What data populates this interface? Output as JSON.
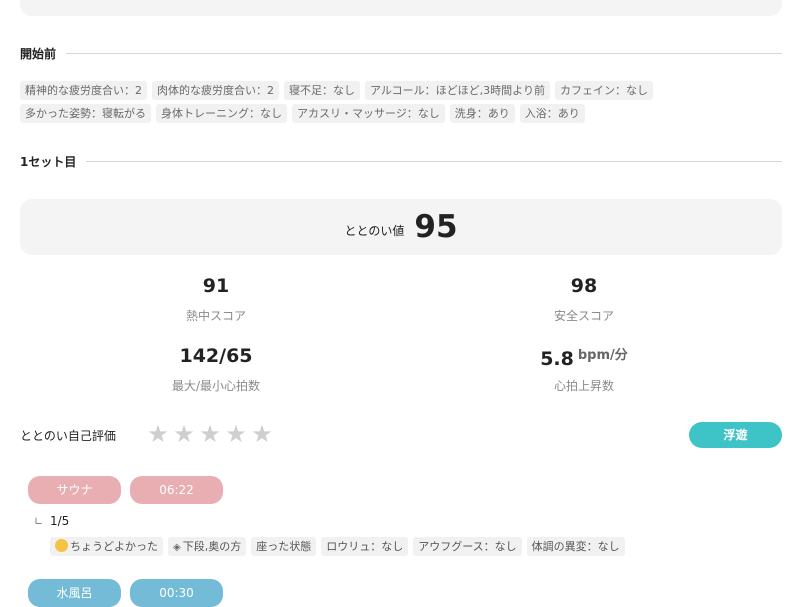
{
  "before": {
    "title": "開始前",
    "tags": [
      "精神的な疲労度合い：2",
      "肉体的な疲労度合い：2",
      "寝不足：なし",
      "アルコール：ほどほど,3時間より前",
      "カフェイン：なし",
      "多かった姿勢：寝転がる",
      "身体トレーニング：なし",
      "アカスリ・マッサージ：なし",
      "洗身：あり",
      "入浴：あり"
    ]
  },
  "set1": {
    "title": "1セット目",
    "ttn_label": "ととのい値",
    "ttn_value": "95",
    "metrics": {
      "heat_score": "91",
      "heat_label": "熱中スコア",
      "safe_score": "98",
      "safe_label": "安全スコア",
      "hr_range": "142/65",
      "hr_range_label": "最大/最小心拍数",
      "hr_rise": "5.8",
      "hr_rise_unit": "bpm/分",
      "hr_rise_label": "心拍上昇数"
    },
    "rating_label": "ととのい自己評価",
    "stars_filled": 0,
    "stars_total": 5,
    "state_badge": "浮遊",
    "sauna": {
      "label": "サウナ",
      "time": "06:22",
      "count": "1/5",
      "tags": [
        "ちょうどよかった",
        "下段,奥の方",
        "座った状態",
        "ロウリュ：なし",
        "アウフグース：なし",
        "体調の異変：なし"
      ]
    },
    "water": {
      "label": "水風呂",
      "time": "00:30"
    }
  },
  "icons": {
    "star": "star-icon",
    "face": "smile-face-icon",
    "tier": "layers-icon",
    "corner": "sub-item-corner-icon"
  },
  "colors": {
    "float_badge": "#3ec3c6",
    "sauna": "#e8aeb1",
    "water": "#74bbd8",
    "card_bg": "#f4f4f4"
  }
}
